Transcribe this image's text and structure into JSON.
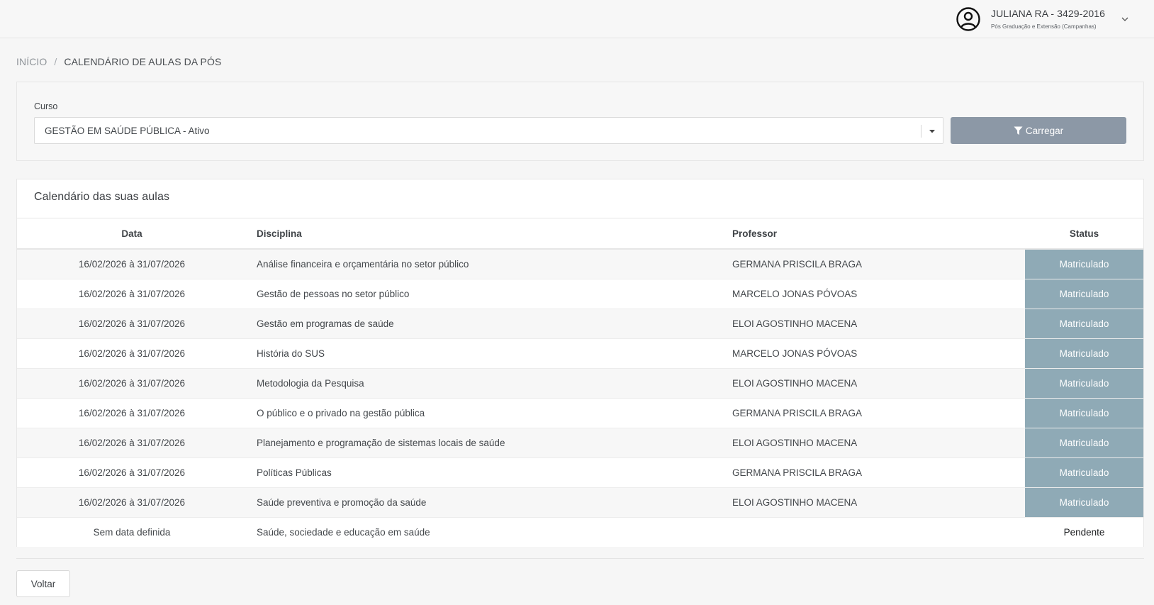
{
  "header": {
    "user_name": "JULIANA RA - 3429-2016",
    "user_subtitle": "Pós Graduação e Extensão (Campanhas)"
  },
  "breadcrumb": {
    "home": "INÍCIO",
    "separator": "/",
    "current": "CALENDÁRIO DE AULAS DA PÓS"
  },
  "filter": {
    "course_label": "Curso",
    "course_value": "GESTÃO EM SAÚDE PÚBLICA - Ativo",
    "load_button": "Carregar"
  },
  "calendar": {
    "title": "Calendário das suas aulas",
    "columns": [
      "Data",
      "Disciplina",
      "Professor",
      "Status"
    ],
    "rows": [
      {
        "date": "16/02/2026 à 31/07/2026",
        "discipline": "Análise financeira e orçamentária no setor público",
        "professor": "GERMANA PRISCILA BRAGA",
        "status": "Matriculado"
      },
      {
        "date": "16/02/2026 à 31/07/2026",
        "discipline": "Gestão de pessoas no setor público",
        "professor": "MARCELO JONAS PÓVOAS",
        "status": "Matriculado"
      },
      {
        "date": "16/02/2026 à 31/07/2026",
        "discipline": "Gestão em programas de saúde",
        "professor": "ELOI AGOSTINHO MACENA",
        "status": "Matriculado"
      },
      {
        "date": "16/02/2026 à 31/07/2026",
        "discipline": "História do SUS",
        "professor": "MARCELO JONAS PÓVOAS",
        "status": "Matriculado"
      },
      {
        "date": "16/02/2026 à 31/07/2026",
        "discipline": "Metodologia da Pesquisa",
        "professor": "ELOI AGOSTINHO MACENA",
        "status": "Matriculado"
      },
      {
        "date": "16/02/2026 à 31/07/2026",
        "discipline": "O público e o privado na gestão pública",
        "professor": "GERMANA PRISCILA BRAGA",
        "status": "Matriculado"
      },
      {
        "date": "16/02/2026 à 31/07/2026",
        "discipline": "Planejamento e programação de sistemas locais de saúde",
        "professor": "ELOI AGOSTINHO MACENA",
        "status": "Matriculado"
      },
      {
        "date": "16/02/2026 à 31/07/2026",
        "discipline": "Políticas Públicas",
        "professor": "GERMANA PRISCILA BRAGA",
        "status": "Matriculado"
      },
      {
        "date": "16/02/2026 à 31/07/2026",
        "discipline": "Saúde preventiva e promoção da saúde",
        "professor": "ELOI AGOSTINHO MACENA",
        "status": "Matriculado"
      },
      {
        "date": "Sem data definida",
        "discipline": "Saúde, sociedade e educação em saúde",
        "professor": "",
        "status": "Pendente"
      }
    ]
  },
  "footer": {
    "back_button": "Voltar"
  },
  "colors": {
    "enrolled_badge": "#8faab6",
    "load_button": "#8c98a6",
    "background": "#f6f6f6"
  },
  "icons": {
    "avatar": "user-circle-icon",
    "caret": "chevron-down-icon",
    "filter": "filter-icon"
  }
}
